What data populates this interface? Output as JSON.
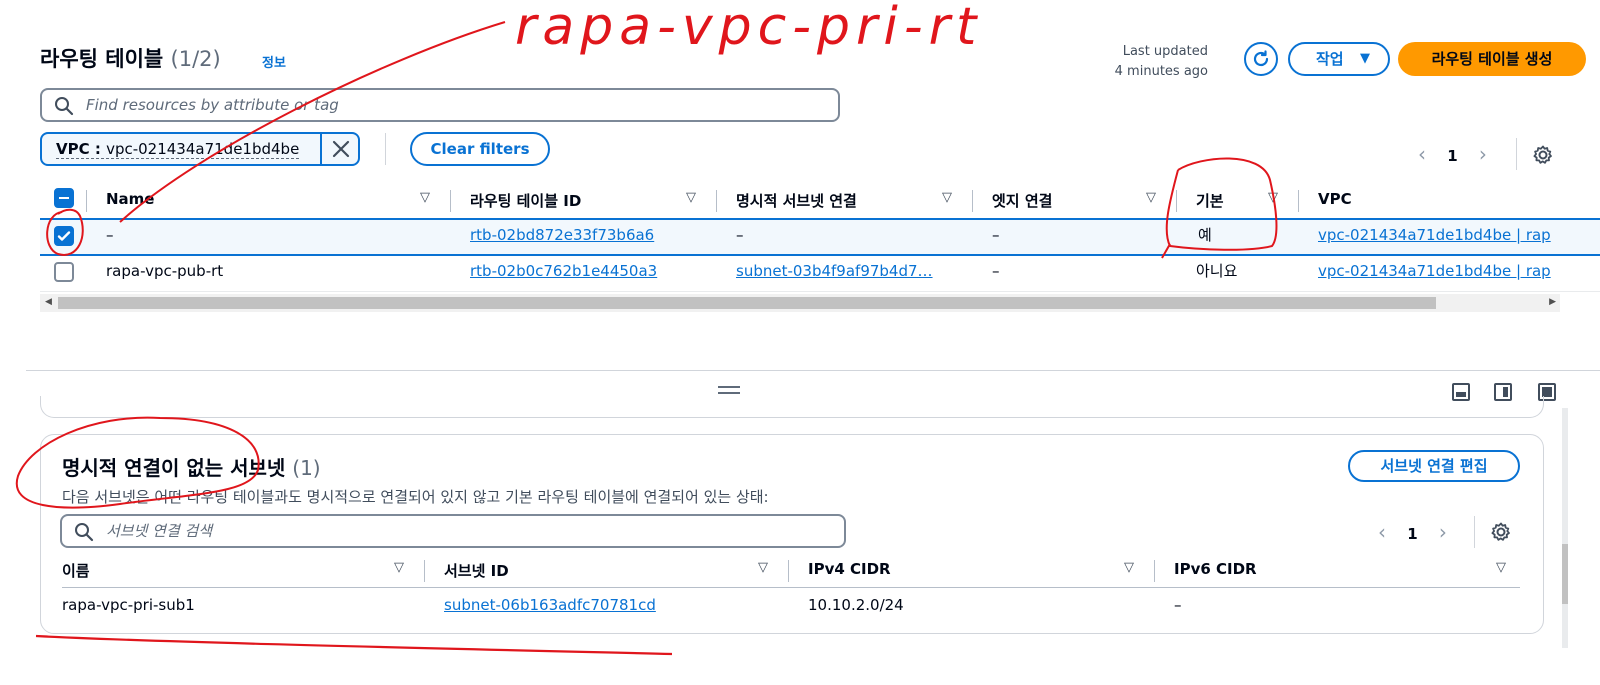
{
  "header": {
    "title": "라우팅 테이블",
    "count": "(1/2)",
    "info": "정보",
    "last_updated_label": "Last updated",
    "last_updated_value": "4 minutes ago",
    "actions_label": "작업",
    "create_label": "라우팅 테이블 생성"
  },
  "search": {
    "placeholder": "Find resources by attribute or tag"
  },
  "filter": {
    "key": "VPC",
    "value": "vpc-021434a71de1bd4be",
    "clear_label": "Clear filters"
  },
  "pagination": {
    "page": "1"
  },
  "table": {
    "columns": [
      "Name",
      "라우팅 테이블 ID",
      "명시적 서브넷 연결",
      "엣지 연결",
      "기본",
      "VPC"
    ],
    "rows": [
      {
        "selected": true,
        "name": "–",
        "id": "rtb-02bd872e33f73b6a6",
        "subnet": "–",
        "edge": "–",
        "main": "예",
        "vpc": "vpc-021434a71de1bd4be | rap"
      },
      {
        "selected": false,
        "name": "rapa-vpc-pub-rt",
        "id": "rtb-02b0c762b1e4450a3",
        "subnet": "subnet-03b4f9af97b4d7…",
        "edge": "–",
        "main": "아니요",
        "vpc": "vpc-021434a71de1bd4be | rap"
      }
    ]
  },
  "panel": {
    "title": "명시적 연결이 없는 서브넷",
    "count": "(1)",
    "description": "다음 서브넷은 어떤 라우팅 테이블과도 명시적으로 연결되어 있지 않고 기본 라우팅 테이블에 연결되어 있는 상태:",
    "edit_label": "서브넷 연결 편집",
    "search_placeholder": "서브넷 연결 검색",
    "page": "1",
    "columns": [
      "이름",
      "서브넷 ID",
      "IPv4 CIDR",
      "IPv6 CIDR"
    ],
    "rows": [
      {
        "name": "rapa-vpc-pri-sub1",
        "subnet_id": "subnet-06b163adfc70781cd",
        "ipv4": "10.10.2.0/24",
        "ipv6": "–"
      }
    ]
  },
  "annotations": {
    "handwritten_label": "rapa-vpc-pri-rt"
  },
  "colors": {
    "accent": "#0972d3",
    "primary_button": "#ff9900",
    "annotation": "#e0161c"
  }
}
